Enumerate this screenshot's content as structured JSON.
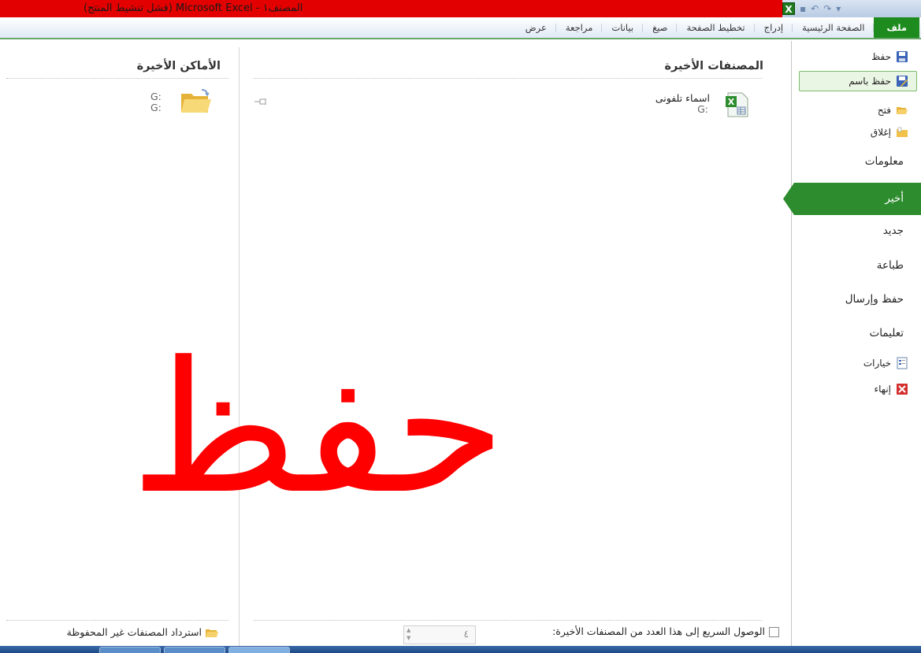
{
  "window": {
    "title": "المصنف١ - Microsoft Excel (فشل تنشيط المنتج)",
    "app_icon": "X"
  },
  "ribbon": {
    "tabs": [
      "ملف",
      "الصفحة الرئيسية",
      "إدراج",
      "تخطيط الصفحة",
      "صيغ",
      "بيانات",
      "مراجعة",
      "عرض"
    ]
  },
  "nav": {
    "save": "حفظ",
    "save_as": "حفظ باسم",
    "open": "فتح",
    "close": "إغلاق",
    "info": "معلومات",
    "recent": "أخير",
    "new": "جديد",
    "print": "طباعة",
    "save_send": "حفظ وإرسال",
    "help": "تعليمات",
    "options": "خيارات",
    "exit": "إنهاء"
  },
  "recent_workbooks": {
    "title": "المصنفات الأخيرة",
    "items": [
      {
        "name": "اسماء تلفونى",
        "path": "G:"
      }
    ]
  },
  "recent_places": {
    "title": "الأماكن الأخيرة",
    "items": [
      {
        "name": "G:",
        "path": "G:"
      }
    ]
  },
  "watermark": "حفظ",
  "bottom": {
    "quick_access_label": "الوصول السريع إلى هذا العدد من المصنفات الأخيرة:",
    "quick_access_count": "٤",
    "quick_access_checked": false,
    "recover_label": "استرداد المصنفات غير المحفوظة"
  },
  "colors": {
    "title_bar": "#e30000",
    "file_tab": "#1e8b1e",
    "selected_nav": "#2d8c2d",
    "watermark": "#ff0000"
  }
}
